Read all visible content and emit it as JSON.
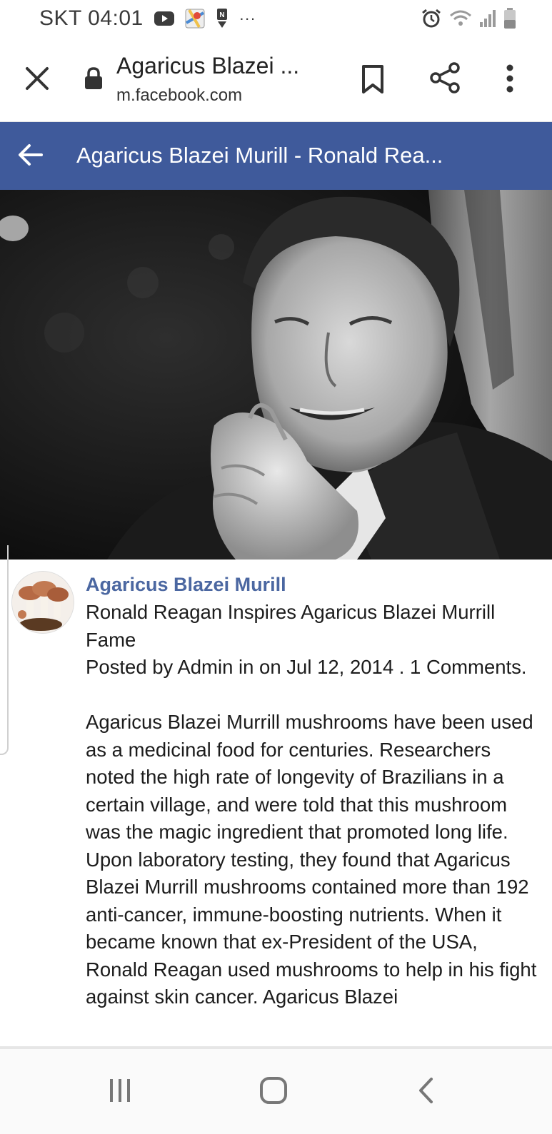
{
  "status_bar": {
    "carrier_time": "SKT 04:01",
    "overflow": "···",
    "left_icons": [
      "youtube-icon",
      "maps-icon",
      "notification-n-icon"
    ],
    "right_icons": [
      "alarm-icon",
      "wifi-icon",
      "signal-icon",
      "battery-icon"
    ]
  },
  "browser": {
    "page_title": "Agaricus Blazei ...",
    "domain": "m.facebook.com",
    "icons": [
      "close-icon",
      "lock-icon",
      "bookmark-icon",
      "share-icon",
      "more-vert-icon"
    ]
  },
  "header": {
    "title": "Agaricus Blazei Murill - Ronald Rea...",
    "back_icon": "arrow-left-icon",
    "color": "#3f5a9b"
  },
  "post": {
    "page_name": "Agaricus Blazei Murill",
    "page_name_color": "#4b67a1",
    "headline": "Ronald Reagan Inspires Agaricus Blazei Murrill Fame",
    "meta": "Posted by Admin in on Jul 12, 2014 . 1 Comments.",
    "body": "Agaricus Blazei Murrill mushrooms have been used as a medicinal food for centuries. Researchers noted the high rate of longevity of Brazilians in a certain village, and were told that this mushroom was the magic ingredient that promoted long life. Upon laboratory testing, they found that Agaricus Blazei Murrill mushrooms contained more than 192 anti-cancer, immune-boosting nutrients. When it became known that ex-President of the USA, Ronald Reagan used mushrooms to help in his fight against skin cancer. Agaricus Blazei"
  },
  "nav": {
    "icons": [
      "recent-apps-icon",
      "home-icon",
      "back-icon"
    ]
  }
}
